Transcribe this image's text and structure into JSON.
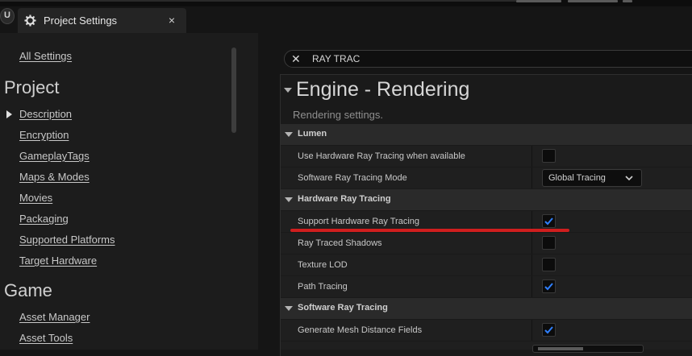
{
  "tab": {
    "title": "Project Settings",
    "close_glyph": "×",
    "icon": "settings-cog-icon"
  },
  "sidebar": {
    "all_settings": "All Settings",
    "sections": [
      {
        "title": "Project",
        "items": [
          "Description",
          "Encryption",
          "GameplayTags",
          "Maps & Modes",
          "Movies",
          "Packaging",
          "Supported Platforms",
          "Target Hardware"
        ]
      },
      {
        "title": "Game",
        "items": [
          "Asset Manager",
          "Asset Tools"
        ]
      }
    ]
  },
  "search": {
    "value": "RAY TRAC",
    "clear_icon": "close-icon"
  },
  "panel": {
    "title": "Engine - Rendering",
    "description": "Rendering settings.",
    "categories": [
      {
        "label": "Lumen",
        "rows": [
          {
            "label": "Use Hardware Ray Tracing when available",
            "type": "checkbox",
            "checked": false
          },
          {
            "label": "Software Ray Tracing Mode",
            "type": "dropdown",
            "value": "Global Tracing"
          }
        ]
      },
      {
        "label": "Hardware Ray Tracing",
        "rows": [
          {
            "label": "Support Hardware Ray Tracing",
            "type": "checkbox",
            "checked": true
          },
          {
            "label": "Ray Traced Shadows",
            "type": "checkbox",
            "checked": false
          },
          {
            "label": "Texture LOD",
            "type": "checkbox",
            "checked": false
          },
          {
            "label": "Path Tracing",
            "type": "checkbox",
            "checked": true
          }
        ]
      },
      {
        "label": "Software Ray Tracing",
        "rows": [
          {
            "label": "Generate Mesh Distance Fields",
            "type": "checkbox",
            "checked": true
          }
        ]
      }
    ]
  },
  "colors": {
    "accent_check": "#2f80ff",
    "annotation_red": "#d01e1e"
  }
}
